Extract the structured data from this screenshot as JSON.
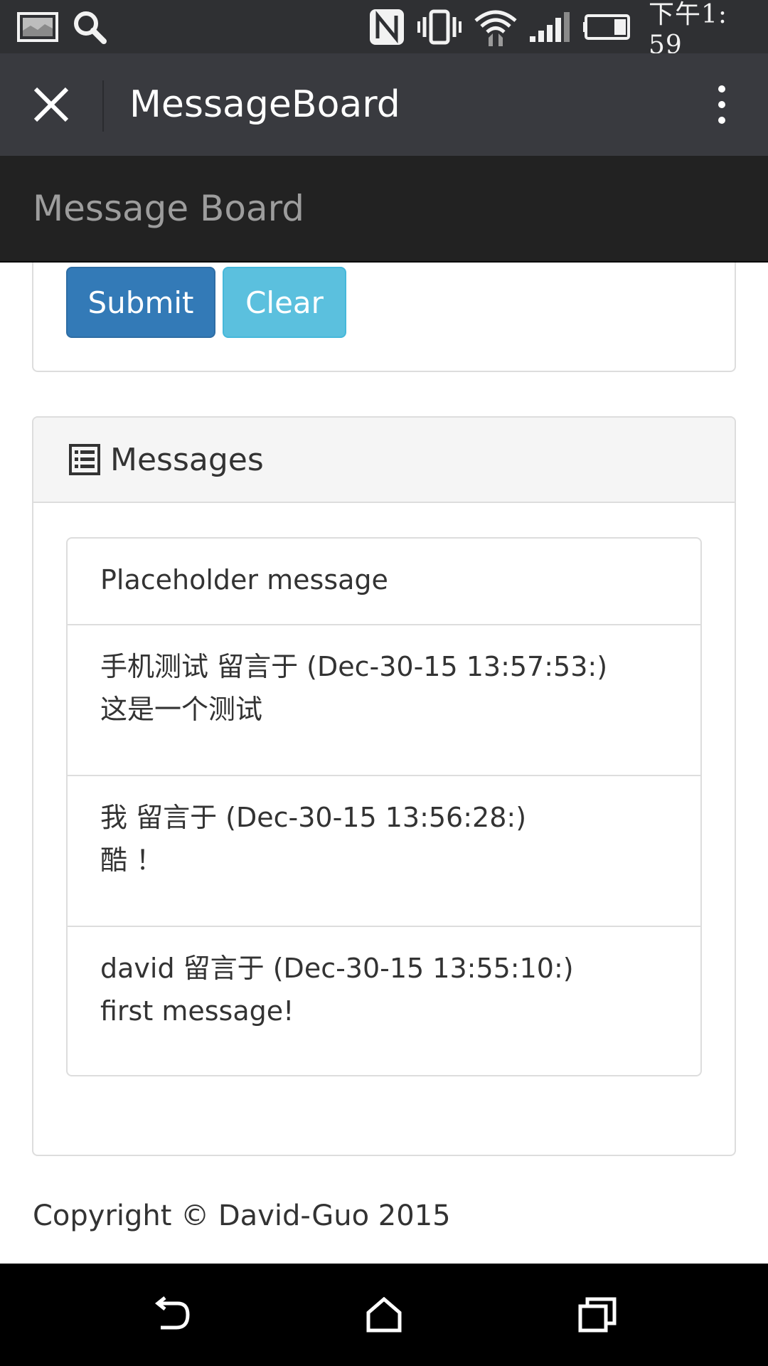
{
  "status_bar": {
    "time": "下午1: 59",
    "icons": [
      "gallery-icon",
      "search-icon",
      "nfc-icon",
      "vibrate-icon",
      "wifi-icon",
      "signal-icon",
      "battery-icon"
    ]
  },
  "top_bar": {
    "title": "MessageBoard",
    "close_icon": "close-icon",
    "more_icon": "more-vertical-icon"
  },
  "navbar": {
    "brand": "Message Board"
  },
  "form": {
    "submit_label": "Submit",
    "clear_label": "Clear"
  },
  "messages_panel": {
    "title": "Messages",
    "icon": "list-icon",
    "placeholder": "Placeholder message",
    "items": [
      {
        "header": "手机测试 留言于 (Dec-30-15 13:57:53:)",
        "body": "这是一个测试"
      },
      {
        "header": "我 留言于 (Dec-30-15 13:56:28:)",
        "body": "酷 ！"
      },
      {
        "header": "david 留言于 (Dec-30-15 13:55:10:)",
        "body": "first message!"
      }
    ]
  },
  "footer": {
    "copyright": "Copyright © David-Guo 2015"
  },
  "nav_bar": {
    "icons": [
      "back-icon",
      "home-icon",
      "recents-icon"
    ]
  },
  "colors": {
    "status_bar_bg": "#2f3033",
    "top_bar_bg": "#393a3f",
    "navbar_bg": "#222222",
    "brand_text": "#9d9d9d",
    "submit_bg": "#337ab7",
    "clear_bg": "#5bc0de",
    "panel_heading_bg": "#f5f5f5",
    "border": "#dddddd"
  }
}
